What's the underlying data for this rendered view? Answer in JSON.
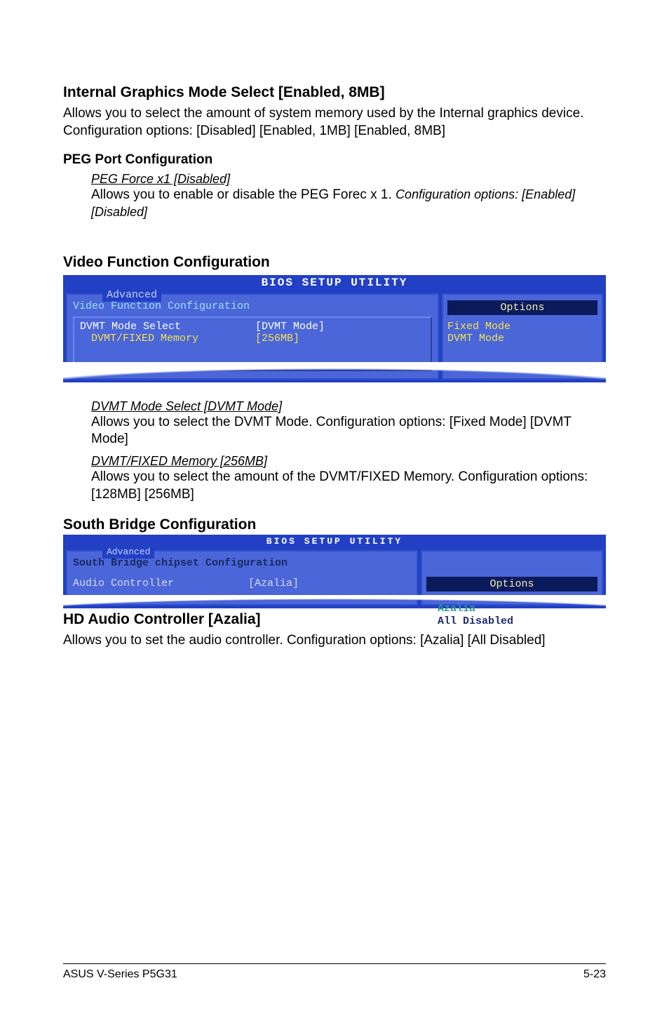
{
  "sec1": {
    "heading": "Internal Graphics Mode Select [Enabled, 8MB]",
    "para": "Allows you to select the amount of system memory used by the Internal graphics device. Configuration options: [Disabled] [Enabled, 1MB] [Enabled, 8MB]"
  },
  "sec_peg": {
    "heading": "PEG Port Configuration",
    "item_title": "PEG Force x1 [Disabled]",
    "item_body_a": "Allows you to enable or disable the PEG Forec x 1. ",
    "item_body_b": "Configuration options: [Enabled] [Disabled]"
  },
  "sec_vfc": {
    "heading": "Video Function Configuration"
  },
  "bios1": {
    "header": "BIOS SETUP UTILITY",
    "tab": "Advanced",
    "panel_title": "Video Function Configuration",
    "row1_label": "DVMT Mode Select",
    "row1_val": "[DVMT Mode]",
    "row2_label": "DVMT/FIXED Memory",
    "row2_val": "[256MB]",
    "options_label": "Options",
    "opt1": "Fixed Mode",
    "opt2": "DVMT Mode"
  },
  "dvmt_mode": {
    "title": "DVMT Mode Select [DVMT Mode]",
    "body": "Allows you to select the DVMT Mode. Configuration options: [Fixed Mode] [DVMT Mode]"
  },
  "dvmt_mem": {
    "title": "DVMT/FIXED Memory [256MB]",
    "body": "Allows you to select the amount of the DVMT/FIXED Memory. Configuration options: [128MB] [256MB]"
  },
  "sec_sbc": {
    "heading": "South Bridge Configuration"
  },
  "bios2": {
    "header": "BIOS SETUP UTILITY",
    "tab": "Advanced",
    "panel_title": "South Bridge chipset Configuration",
    "row1_label": "Audio Controller",
    "row1_val": "[Azalia]",
    "options_label": "Options",
    "opt1": "Azalia",
    "opt2": "All Disabled"
  },
  "sec_hd": {
    "heading": "HD Audio Controller [Azalia]",
    "para": "Allows you to set the audio controller. Configuration options: [Azalia] [All Disabled]"
  },
  "footer": {
    "left": "ASUS  V-Series P5G31",
    "right": "5-23"
  }
}
